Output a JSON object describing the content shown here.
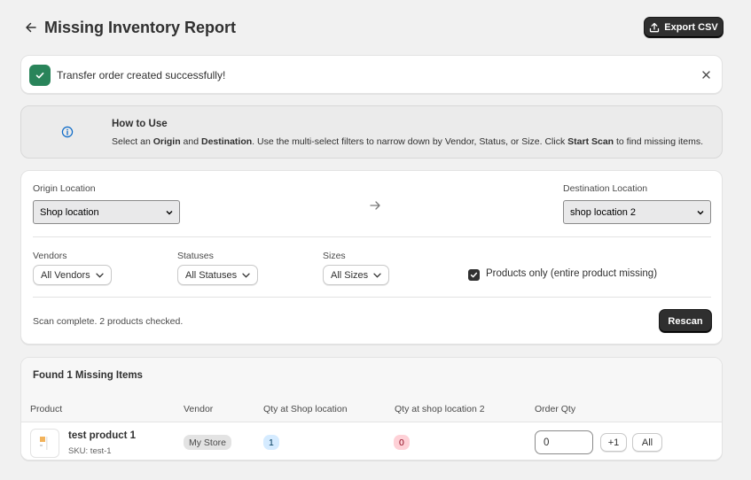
{
  "header": {
    "title": "Missing Inventory Report",
    "export_label": "Export CSV"
  },
  "banner": {
    "message": "Transfer order created successfully!"
  },
  "how_to_use": {
    "title": "How to Use",
    "text_1": "Select an ",
    "origin": "Origin",
    "text_2": " and ",
    "destination": "Destination",
    "text_3": ". Use the multi-select filters to narrow down by Vendor, Status, or Size. Click ",
    "start_scan": "Start Scan",
    "text_4": " to find missing items."
  },
  "filters": {
    "origin_label": "Origin Location",
    "origin_value": "Shop location",
    "destination_label": "Destination Location",
    "destination_value": "shop location 2",
    "vendors_label": "Vendors",
    "vendors_value": "All Vendors",
    "statuses_label": "Statuses",
    "statuses_value": "All Statuses",
    "sizes_label": "Sizes",
    "sizes_value": "All Sizes",
    "products_only_label": "Products only (entire product missing)",
    "products_only_checked": true,
    "scan_status": "Scan complete. 2 products checked.",
    "rescan_label": "Rescan"
  },
  "results": {
    "title": "Found 1 Missing Items",
    "columns": [
      "Product",
      "Vendor",
      "Qty at Shop location",
      "Qty at shop location 2",
      "Order Qty"
    ],
    "rows": [
      {
        "product": "test product 1",
        "sku": "SKU: test-1",
        "vendor": "My Store",
        "qty_origin": "1",
        "qty_destination": "0",
        "order_qty": "0",
        "plus_one_label": "+1",
        "all_label": "All"
      }
    ]
  },
  "colors": {
    "success": "#29845a",
    "primary_button": "#2f2f2f",
    "info_icon": "#0b69c7",
    "qty_origin_badge": "#d5ebff",
    "qty_destination_badge": "#fed1d7"
  }
}
